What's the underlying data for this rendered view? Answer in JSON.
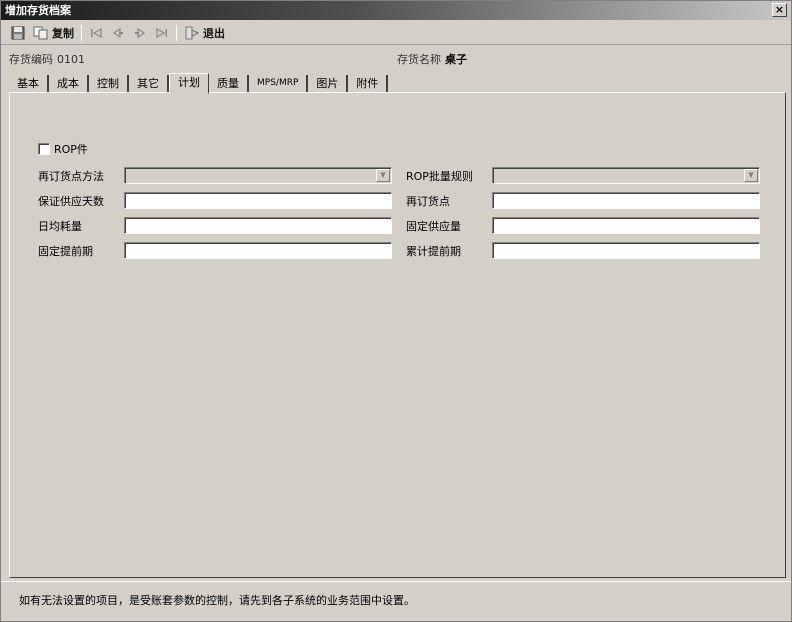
{
  "window": {
    "title": "增加存货档案",
    "close_glyph": "×"
  },
  "toolbar": {
    "save_icon": "save-icon",
    "copy_icon": "copy-icon",
    "copy_label": "复制",
    "first_icon": "first-record-icon",
    "prev_icon": "previous-record-icon",
    "next_icon": "next-record-icon",
    "last_icon": "last-record-icon",
    "exit_icon": "exit-icon",
    "exit_label": "退出"
  },
  "info": {
    "code_label": "存货编码",
    "code_value": "0101",
    "name_label": "存货名称",
    "name_value": "桌子"
  },
  "tabs": [
    {
      "label": "基本"
    },
    {
      "label": "成本"
    },
    {
      "label": "控制"
    },
    {
      "label": "其它"
    },
    {
      "label": "计划",
      "active": true
    },
    {
      "label": "质量"
    },
    {
      "label": "MPS/MRP"
    },
    {
      "label": "图片"
    },
    {
      "label": "附件"
    }
  ],
  "plan": {
    "rop_checkbox": {
      "label": "ROP件",
      "checked": false
    },
    "fields": {
      "reorder_method_label": "再订货点方法",
      "reorder_method_value": "",
      "rop_batch_rule_label": "ROP批量规则",
      "rop_batch_rule_value": "",
      "guarantee_days_label": "保证供应天数",
      "guarantee_days_value": "",
      "reorder_point_label": "再订货点",
      "reorder_point_value": "",
      "daily_consumption_label": "日均耗量",
      "daily_consumption_value": "",
      "fixed_supply_label": "固定供应量",
      "fixed_supply_value": "",
      "fixed_lead_time_label": "固定提前期",
      "fixed_lead_time_value": "",
      "cumulative_lead_time_label": "累计提前期",
      "cumulative_lead_time_value": ""
    }
  },
  "status": {
    "message": "如有无法设置的项目，是受账套参数的控制，请先到各子系统的业务范围中设置。"
  }
}
